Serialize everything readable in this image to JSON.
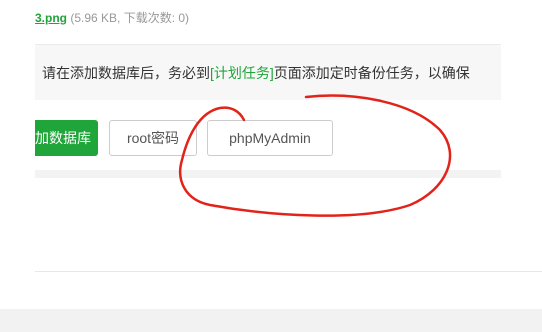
{
  "attachment": {
    "filename": "3.png",
    "meta": "(5.96 KB, 下载次数: 0)"
  },
  "notice": {
    "prefix": "请在添加数据库后，务必到",
    "link": "[计划任务]",
    "suffix": "页面添加定时备份任务，以确保"
  },
  "toolbar": {
    "add_label": "加数据库",
    "root_password_label": "root密码",
    "phpmyadmin_label": "phpMyAdmin"
  },
  "colors": {
    "accent": "#20a53a",
    "annotation": "#e2231a"
  },
  "annotation": {
    "shape": "hand-drawn-circle"
  }
}
